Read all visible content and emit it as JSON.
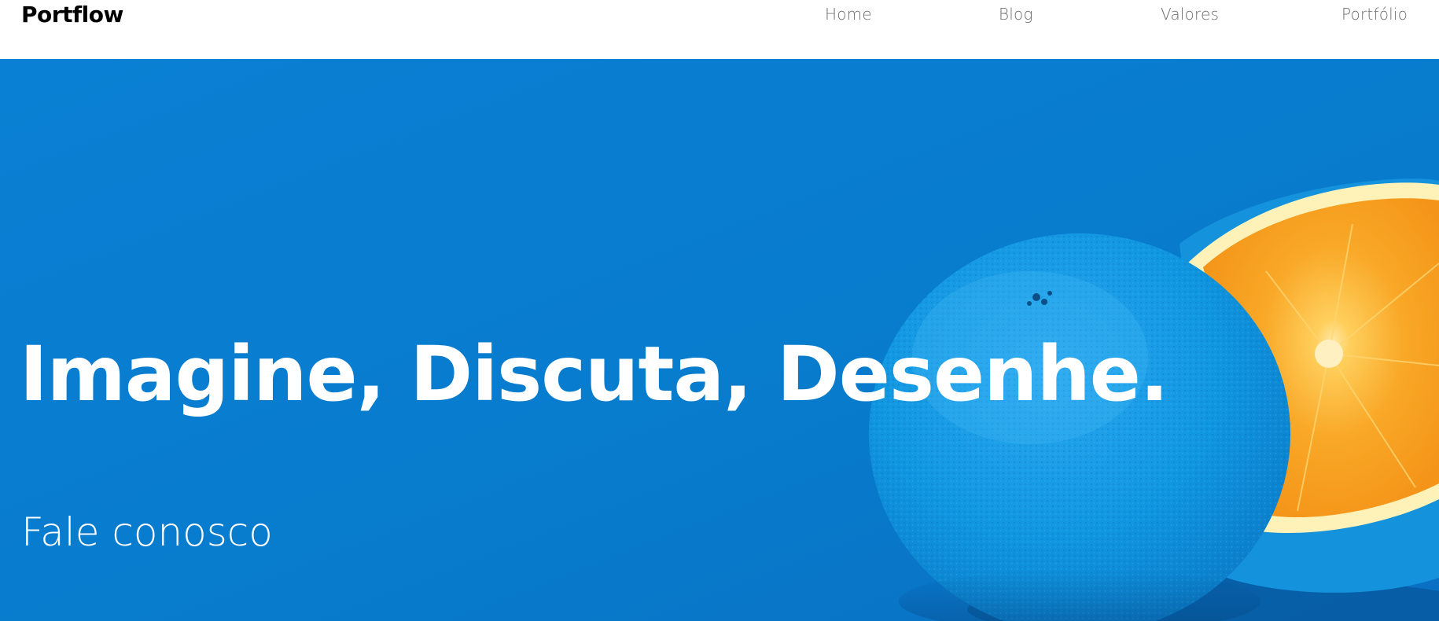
{
  "header": {
    "brand": "Portflow",
    "nav": [
      {
        "label": "Home"
      },
      {
        "label": "Blog"
      },
      {
        "label": "Valores"
      },
      {
        "label": "Portfólio"
      }
    ]
  },
  "hero": {
    "title": "Imagine, Discuta, Desenhe.",
    "cta_label": "Fale conosco",
    "background_image": "blue-painted-orange-photo",
    "colors": {
      "background": "#0a7fd2",
      "text": "#ffffff",
      "orange": "#f7a21b"
    }
  }
}
